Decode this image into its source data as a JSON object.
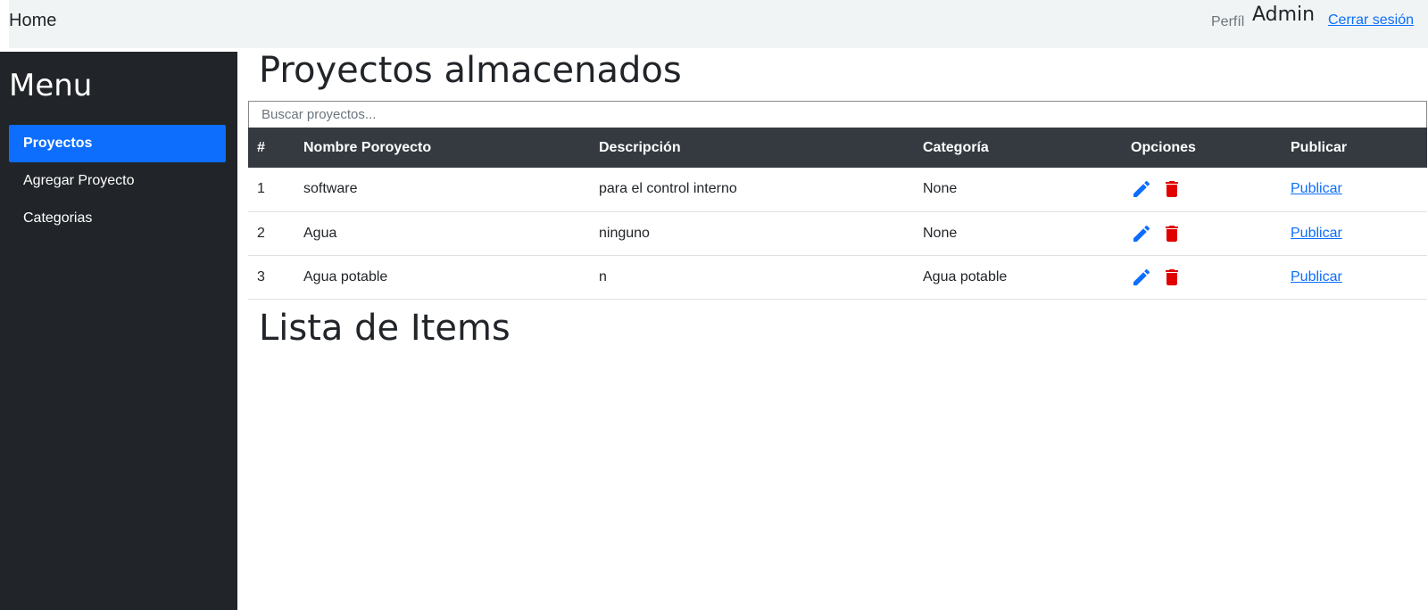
{
  "topbar": {
    "home": "Home",
    "perfil": "Perfíl",
    "user": "Admin",
    "logout": "Cerrar sesión"
  },
  "sidebar": {
    "title": "Menu",
    "items": [
      {
        "label": "Proyectos",
        "active": true
      },
      {
        "label": "Agregar Proyecto",
        "active": false
      },
      {
        "label": "Categorias",
        "active": false
      }
    ]
  },
  "main": {
    "title": "Proyectos almacenados",
    "search_placeholder": "Buscar proyectos...",
    "table": {
      "headers": [
        "#",
        "Nombre Poroyecto",
        "Descripción",
        "Categoría",
        "Opciones",
        "Publicar"
      ],
      "rows": [
        {
          "num": "1",
          "name": "software",
          "desc": "para el control interno",
          "cat": "None",
          "publish": "Publicar"
        },
        {
          "num": "2",
          "name": "Agua",
          "desc": "ninguno",
          "cat": "None",
          "publish": "Publicar"
        },
        {
          "num": "3",
          "name": "Agua potable",
          "desc": "n",
          "cat": "Agua potable",
          "publish": "Publicar"
        }
      ]
    },
    "items_title": "Lista de Items"
  },
  "icons": {
    "edit": "pencil-icon",
    "delete": "trash-icon"
  },
  "colors": {
    "primary": "#0d6efd",
    "sidebar_bg": "#212529",
    "table_header_bg": "#343a40",
    "danger": "#e00000",
    "topbar_bg": "#f0f4f4"
  }
}
